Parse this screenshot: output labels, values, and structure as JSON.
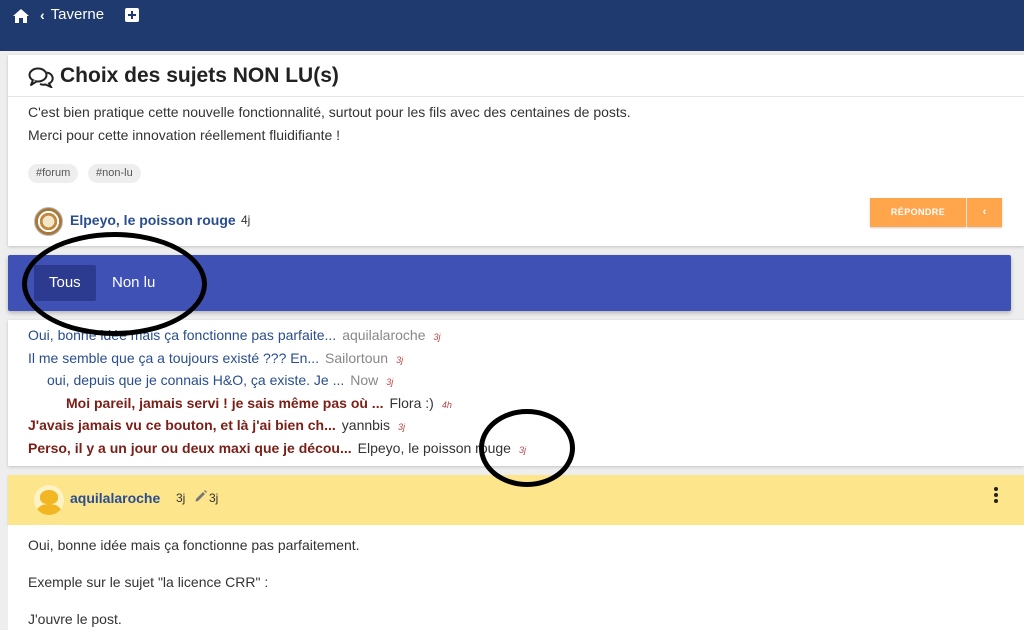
{
  "nav": {
    "back_label": "Taverne",
    "home_icon": "home-icon",
    "add_icon": "plus-square-icon",
    "bar_color": "#1e3a6e"
  },
  "topic": {
    "title": "Choix des sujets NON LU(s)",
    "title_icon": "comments-icon",
    "body_lines": [
      "C'est bien pratique cette nouvelle fonctionnalité, surtout pour les fils avec des centaines de posts.",
      "Merci pour cette innovation réellement fluidifiante !"
    ],
    "tags": [
      "#forum",
      "#non-lu"
    ],
    "author": "Elpeyo, le poisson rouge",
    "time": "4j",
    "reply_label": "RÉPONDRE",
    "reply_more": "‹",
    "accent_color": "#ffa64d"
  },
  "filter": {
    "tabs": [
      "Tous",
      "Non lu"
    ],
    "active": "Tous",
    "bar_color": "#3f51b5"
  },
  "thread": [
    {
      "subject": "Oui, bonne idée mais ça fonctionne pas parfaite...",
      "user": "aquilalaroche",
      "time": "3j",
      "style": "blue"
    },
    {
      "subject": "Il me semble que ça a toujours existé ??? En...",
      "user": "Sailortoun",
      "time": "3j",
      "style": "blue"
    },
    {
      "subject": "oui, depuis que je connais H&O, ça existe. Je ...",
      "user": "Now",
      "time": "3j",
      "style": "blue"
    },
    {
      "subject": "Moi pareil, jamais servi ! je sais même pas où ...",
      "user": "Flora :)",
      "time": "4h",
      "style": "red"
    },
    {
      "subject": "J'avais jamais vu ce bouton, et là j'ai bien ch...",
      "user": "yannbis",
      "time": "3j",
      "style": "red"
    },
    {
      "subject": "Perso, il y a un jour ou deux maxi que je décou...",
      "user": "Elpeyo, le poisson rouge",
      "time": "3j",
      "style": "red"
    }
  ],
  "message": {
    "user": "aquilalaroche",
    "time": "3j",
    "edit_icon": "pencil-icon",
    "edited_time": "3j",
    "menu_icon": "vertical-dots-icon",
    "header_color": "#fde58b",
    "lines": [
      "Oui, bonne idée mais ça fonctionne pas parfaitement.",
      "Exemple sur le sujet \"la licence CRR\" :",
      "J'ouvre le post."
    ]
  }
}
